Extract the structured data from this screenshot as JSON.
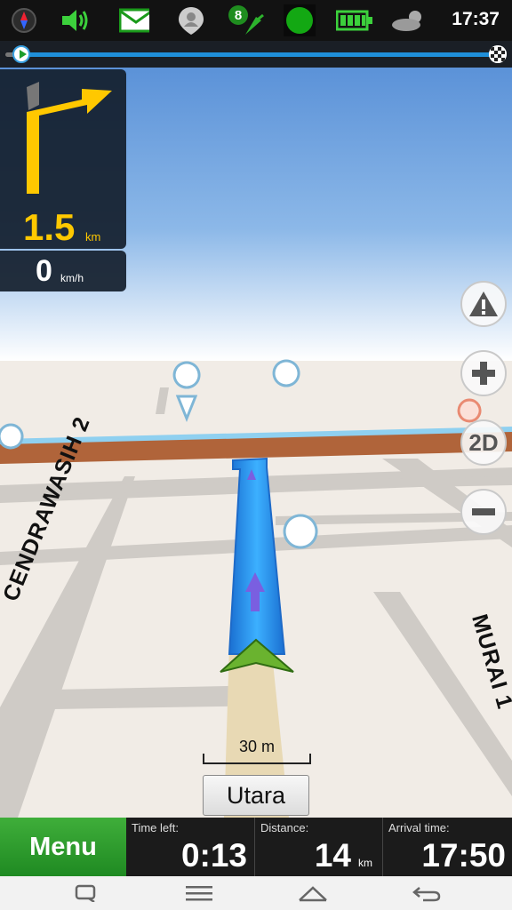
{
  "status_bar": {
    "time": "17:37",
    "satellite_count": "8",
    "icons": [
      "compass-icon",
      "volume-icon",
      "mail-icon",
      "contact-icon",
      "satellite-icon",
      "gps-status-icon",
      "battery-icon",
      "weather-icon"
    ]
  },
  "route_progress": {
    "fraction": 0.01
  },
  "maneuver": {
    "distance": "1.5",
    "distance_unit": "km",
    "speed": "0",
    "speed_unit": "km/h",
    "icon": "turn-right-arrow-icon"
  },
  "map": {
    "roads": {
      "left": "CENDRAWASIH 2",
      "right": "MURAI 1"
    },
    "scale_label": "30 m",
    "street_button": "Utara",
    "controls": {
      "zoom_3d_label": "2D"
    }
  },
  "bottom": {
    "menu_label": "Menu",
    "time_left": {
      "label": "Time left:",
      "value": "0:13"
    },
    "distance": {
      "label": "Distance:",
      "value": "14",
      "unit": "km"
    },
    "arrival": {
      "label": "Arrival time:",
      "value": "17:50"
    }
  },
  "colors": {
    "route": "#1e8fe0",
    "accent": "#ffc800",
    "menu": "#2e9e30"
  }
}
